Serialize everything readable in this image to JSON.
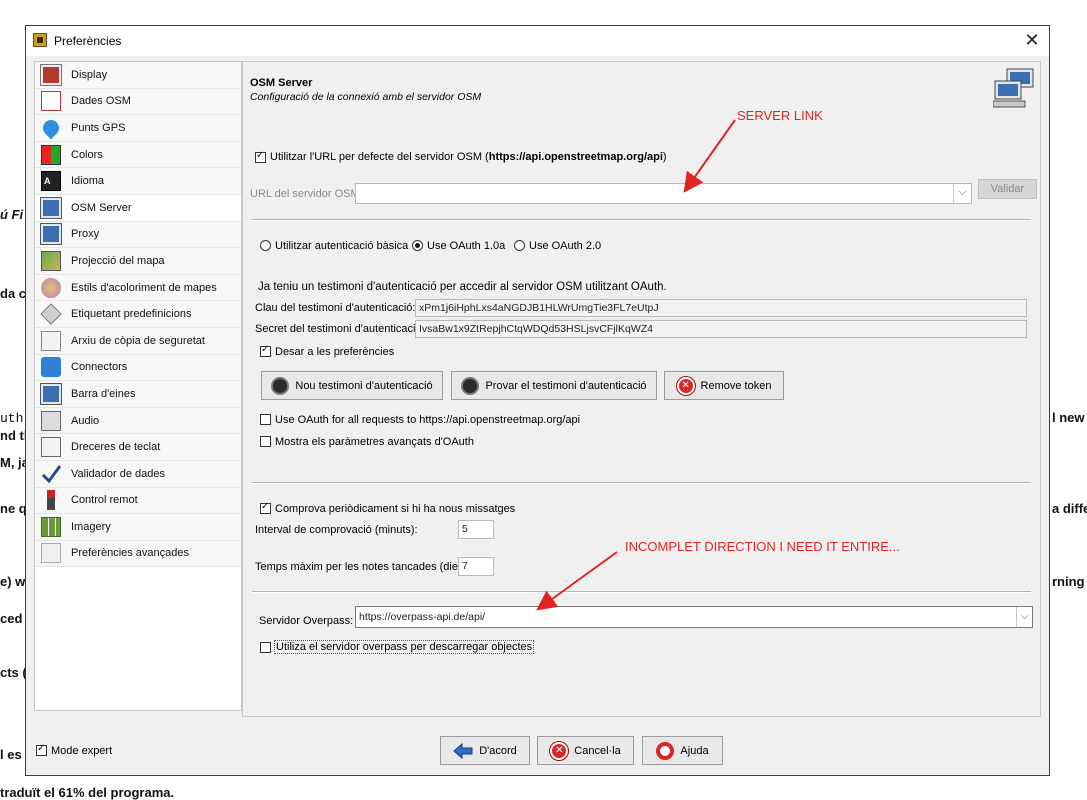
{
  "background_texts": [
    "ú Fi",
    "da c",
    "uth i",
    "nd th",
    "M, ja",
    "ne q",
    "e) wi",
    "ced",
    "cts (",
    "l es",
    "l new",
    "a diffe",
    "rning",
    "traduït el 61% del programa."
  ],
  "window": {
    "title": "Preferències"
  },
  "sidebar": {
    "items": [
      {
        "label": "Display",
        "icon": "display-icon"
      },
      {
        "label": "Dades OSM",
        "icon": "osm-data-icon"
      },
      {
        "label": "Punts GPS",
        "icon": "gps-pin-icon"
      },
      {
        "label": "Colors",
        "icon": "colors-icon"
      },
      {
        "label": "Idioma",
        "icon": "language-icon"
      },
      {
        "label": "OSM Server",
        "icon": "server-icon"
      },
      {
        "label": "Proxy",
        "icon": "proxy-icon"
      },
      {
        "label": "Projecció del mapa",
        "icon": "map-projection-icon"
      },
      {
        "label": "Estils d'acoloriment de mapes",
        "icon": "map-styles-icon"
      },
      {
        "label": "Etiquetant predefinicions",
        "icon": "preset-tag-icon"
      },
      {
        "label": "Arxiu de còpia de seguretat",
        "icon": "backup-file-icon"
      },
      {
        "label": "Connectors",
        "icon": "plugin-icon"
      },
      {
        "label": "Barra d'eines",
        "icon": "toolbar-icon"
      },
      {
        "label": "Audio",
        "icon": "audio-icon"
      },
      {
        "label": "Dreceres de teclat",
        "icon": "keyboard-shortcut-icon"
      },
      {
        "label": "Validador de dades",
        "icon": "validator-checkmark-icon"
      },
      {
        "label": "Control remot",
        "icon": "remote-control-icon"
      },
      {
        "label": "Imagery",
        "icon": "imagery-icon"
      },
      {
        "label": "Preferències avançades",
        "icon": "advanced-preferences-icon"
      }
    ],
    "selected_index": 5
  },
  "expert_mode": {
    "label": "Mode expert",
    "checked": true
  },
  "server": {
    "title": "OSM Server",
    "subtitle": "Configuració de la connexió amb el servidor OSM",
    "default_url_checkbox": {
      "label_prefix": "Utilitzar l'URL per defecte del servidor OSM (",
      "url": "https://api.openstreetmap.org/api",
      "label_suffix": ")",
      "checked": true
    },
    "url_label": "URL del servidor OSM:",
    "url_value": "",
    "validate_label": "Validar"
  },
  "auth": {
    "options": [
      {
        "label": "Utilitzar autenticació bàsica",
        "checked": false
      },
      {
        "label": "Use OAuth 1.0a",
        "checked": true
      },
      {
        "label": "Use OAuth 2.0",
        "checked": false
      }
    ],
    "info": "Ja teniu un testimoni d'autenticació per accedir al servidor OSM utilitzant OAuth.",
    "token_key_label": "Clau del testimoni d'autenticació:",
    "token_key_value": "xPm1j6iHphLxs4aNGDJB1HLWrUmgTie3FL7eUtpJ",
    "token_secret_label": "Secret del testimoni d'autenticació:",
    "token_secret_value": "IvsaBw1x9ZtRepjhCtqWDQd53HSLjsvCFjlKqWZ4",
    "save_checkbox": {
      "label": "Desar a les preferències",
      "checked": true
    },
    "buttons": {
      "new_token": "Nou testimoni d'autenticació",
      "test_token": "Provar el testimoni d'autenticació",
      "remove_token": "Remove token"
    },
    "oauth_all_requests": {
      "label": "Use OAuth for all requests to https://api.openstreetmap.org/api",
      "checked": false
    },
    "advanced_params": {
      "label": "Mostra els paràmetres avançats d'OAuth",
      "checked": false
    }
  },
  "messages": {
    "check_periodically": {
      "label": "Comprova periòdicament si hi ha nous missatges",
      "checked": true
    },
    "interval_label": "Interval de comprovació (minuts):",
    "interval_value": "5",
    "notes_label": "Temps màxim per les notes tancades (dies):",
    "notes_value": "7"
  },
  "overpass": {
    "label": "Servidor Overpass:",
    "value": "https://overpass-api.de/api/",
    "use_checkbox": {
      "label": "Utiliza el servidor overpass per descarregar objectes",
      "checked": false
    }
  },
  "footer": {
    "ok": "D'acord",
    "cancel": "Cancel·la",
    "help": "Ajuda"
  },
  "annotations": {
    "server_link": "SERVER LINK",
    "incomplete": "INCOMPLET DIRECTION I NEED IT ENTIRE..."
  },
  "colors": {
    "annotation": "#e32222",
    "selected_item": "#ffffff",
    "window_bg": "#f0f0f0"
  }
}
